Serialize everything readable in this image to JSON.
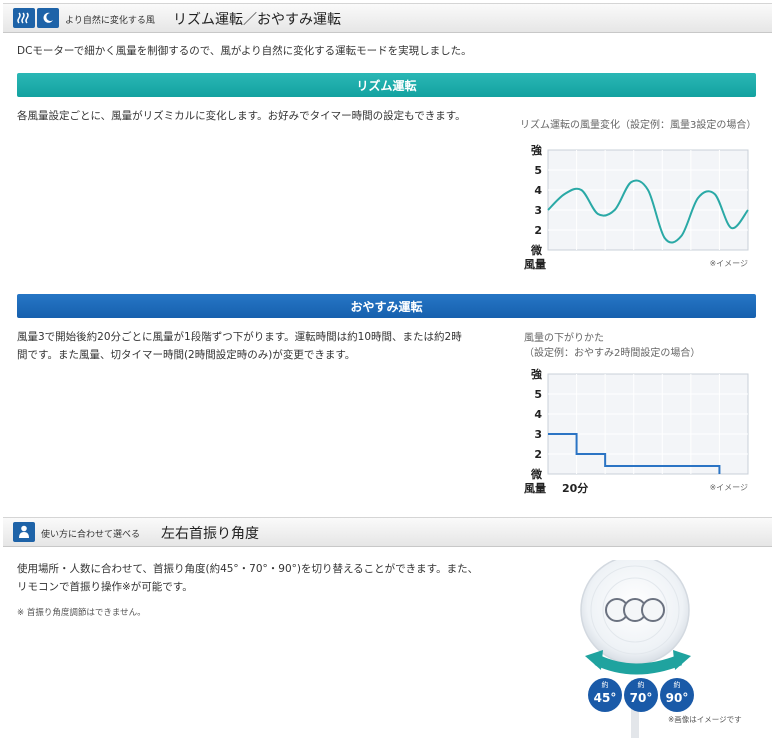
{
  "section1": {
    "small_title": "より自然に変化する風",
    "big_title": "リズム運転／おやすみ運転",
    "intro": "DCモーターで細かく風量を制御するので、風がより自然に変化する運転モードを実現しました。"
  },
  "rhythm": {
    "bar_label": "リズム運転",
    "description": "各風量設定ごとに、風量がリズミカルに変化します。お好みでタイマー時間の設定もできます。",
    "chart_caption": "リズム運転の風量変化（設定例：風量3設定の場合）",
    "image_note": "※イメージ"
  },
  "sleep": {
    "bar_label": "おやすみ運転",
    "description_line1": "風量3で開始後約20分ごとに風量が1段階ずつ下がります。運転時間は約10時間、または約2時",
    "description_line2": "間です。また風量、切タイマー時間(2時間設定時のみ)が変更できます。",
    "chart_caption_line1": "風量の下がりかた",
    "chart_caption_line2": "（設定例：おやすみ2時間設定の場合）",
    "image_note": "※イメージ"
  },
  "section2": {
    "small_title": "使い方に合わせて選べる",
    "big_title": "左右首振り角度",
    "text_line1": "使用場所・人数に合わせて、首振り角度(約45°・70°・90°)を切り替えることができます。また、",
    "text_line2": "リモコンで首振り操作※が可能です。",
    "footnote": "※ 首振り角度調節はできません。",
    "image_note": "※画像はイメージです"
  },
  "chart_data": [
    {
      "type": "line",
      "title": "リズム運転の風量変化（設定例：風量3設定の場合）",
      "ylabel": "風量",
      "y_ticks": [
        "微",
        "2",
        "3",
        "4",
        "5",
        "強"
      ],
      "ylim": [
        1,
        6
      ],
      "x": [
        0,
        1,
        2,
        3,
        4,
        5,
        6,
        7,
        8,
        9,
        10,
        11,
        12
      ],
      "values": [
        3.0,
        3.8,
        4.0,
        2.8,
        3.0,
        4.4,
        4.0,
        1.6,
        1.7,
        3.6,
        3.8,
        2.1,
        3.0
      ],
      "grid": true,
      "color": "#2aa9a6"
    },
    {
      "type": "line",
      "title": "風量の下がりかた（設定例：おやすみ2時間設定の場合）",
      "ylabel": "風量",
      "xlabel": "20分",
      "y_ticks": [
        "微",
        "2",
        "3",
        "4",
        "5",
        "強"
      ],
      "ylim": [
        1,
        6
      ],
      "steps": [
        {
          "from": 0,
          "to": 1,
          "value": 3
        },
        {
          "from": 1,
          "to": 2,
          "value": 2
        },
        {
          "from": 2,
          "to": 6,
          "value": 1.4
        }
      ],
      "end_drop_to": 1,
      "grid": true,
      "color": "#2b74c4"
    }
  ],
  "oscillation": {
    "label_prefix": "約",
    "angles": [
      "45°",
      "70°",
      "90°"
    ],
    "badge_color": "#1a5aa8",
    "arrow_color": "#1fa39f"
  }
}
